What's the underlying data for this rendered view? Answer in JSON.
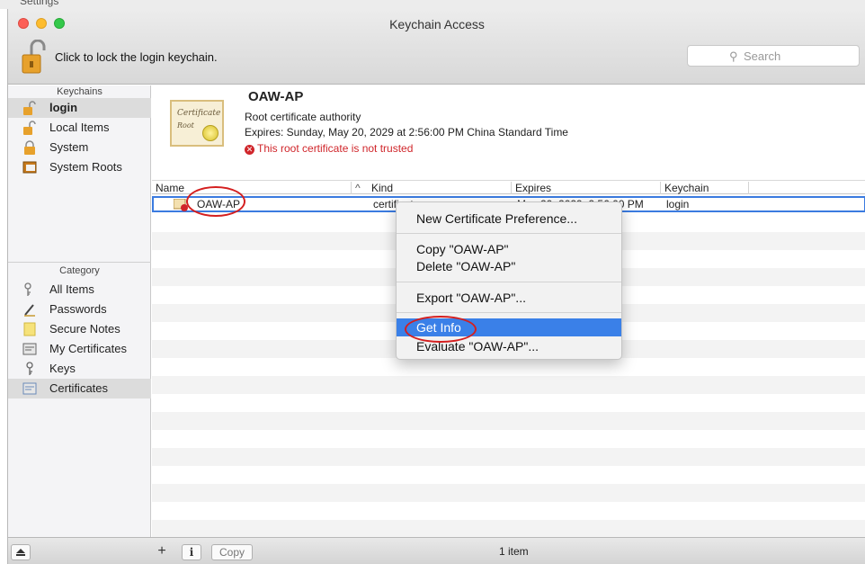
{
  "window": {
    "above_title": "Settings",
    "title": "Keychain Access"
  },
  "toolbar": {
    "lock_hint": "Click to lock the login keychain.",
    "search_placeholder": "Search"
  },
  "sidebar": {
    "keychains_header": "Keychains",
    "keychains": [
      {
        "label": "login",
        "icon": "unlocked-padlock-icon",
        "selected": true
      },
      {
        "label": "Local Items",
        "icon": "unlocked-padlock-icon",
        "selected": false
      },
      {
        "label": "System",
        "icon": "locked-padlock-icon",
        "selected": false
      },
      {
        "label": "System Roots",
        "icon": "cabinet-icon",
        "selected": false
      }
    ],
    "category_header": "Category",
    "categories": [
      {
        "label": "All Items",
        "icon": "keys-icon"
      },
      {
        "label": "Passwords",
        "icon": "pen-icon"
      },
      {
        "label": "Secure Notes",
        "icon": "note-icon"
      },
      {
        "label": "My Certificates",
        "icon": "certificate-icon"
      },
      {
        "label": "Keys",
        "icon": "key-icon"
      },
      {
        "label": "Certificates",
        "icon": "certificate-icon",
        "selected": true
      }
    ]
  },
  "detail": {
    "cert_image_text": "Certificate",
    "cert_image_sub": "Root",
    "name": "OAW-AP",
    "type": "Root certificate authority",
    "expires": "Expires: Sunday, May 20, 2029 at 2:56:00 PM China Standard Time",
    "warning": "This root certificate is not trusted"
  },
  "table": {
    "columns": [
      "Name",
      "Kind",
      "Expires",
      "Keychain"
    ],
    "sort_indicator": "^",
    "rows": [
      {
        "name": "OAW-AP",
        "kind": "certificate",
        "expires": "May 20, 2029, 2:56:00 PM",
        "keychain": "login"
      }
    ]
  },
  "context_menu": {
    "items": [
      "New Certificate Preference...",
      "Copy \"OAW-AP\"",
      "Delete \"OAW-AP\"",
      "Export \"OAW-AP\"...",
      "Get Info",
      "Evaluate \"OAW-AP\"..."
    ],
    "highlighted_index": 4
  },
  "bottom_bar": {
    "add": "+",
    "info": "i",
    "copy": "Copy",
    "count": "1 item"
  },
  "colors": {
    "highlight": "#3a80e8",
    "warning": "#d0262b",
    "annotation": "#d41f1f"
  }
}
